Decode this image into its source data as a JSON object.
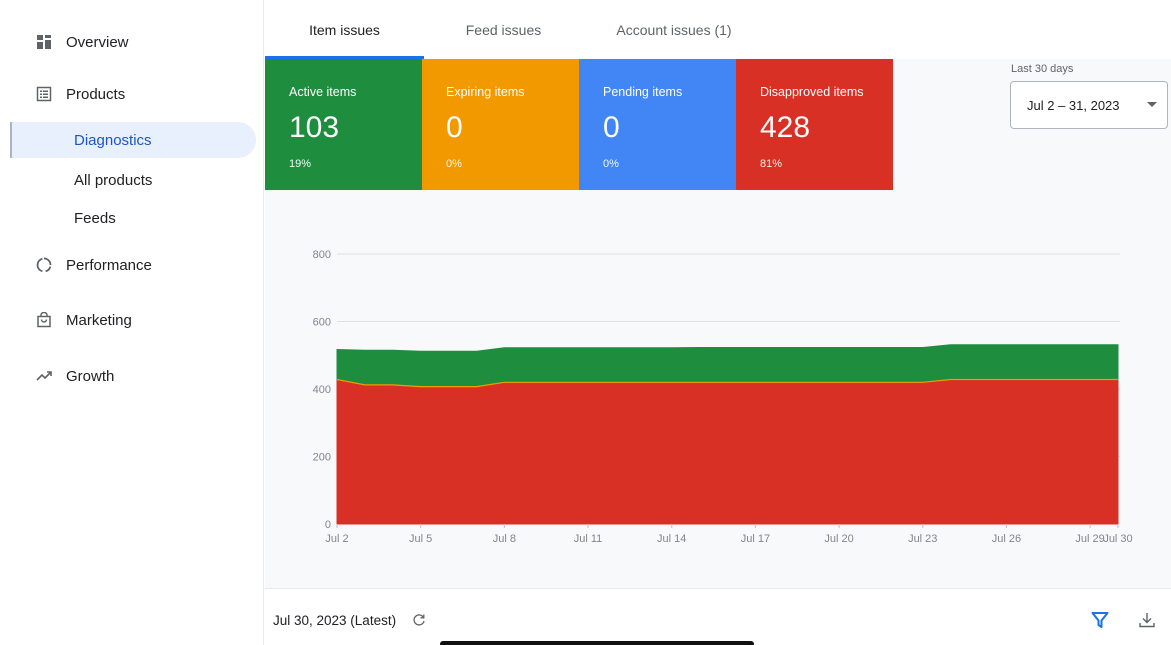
{
  "sidebar": {
    "items": [
      {
        "label": "Overview",
        "icon": "dashboard-icon"
      },
      {
        "label": "Products",
        "icon": "list-icon"
      },
      {
        "label": "Performance",
        "icon": "pie-icon"
      },
      {
        "label": "Marketing",
        "icon": "shopping-bag-icon"
      },
      {
        "label": "Growth",
        "icon": "trending-up-icon"
      }
    ],
    "products_sub": [
      {
        "label": "Diagnostics",
        "active": true
      },
      {
        "label": "All products",
        "active": false
      },
      {
        "label": "Feeds",
        "active": false
      }
    ]
  },
  "tabs": [
    {
      "label": "Item issues",
      "active": true
    },
    {
      "label": "Feed issues",
      "active": false
    },
    {
      "label": "Account issues (1)",
      "active": false
    }
  ],
  "cards": [
    {
      "title": "Active items",
      "value": "103",
      "pct": "19%",
      "color": "#1e8e3e"
    },
    {
      "title": "Expiring items",
      "value": "0",
      "pct": "0%",
      "color": "#f29900"
    },
    {
      "title": "Pending items",
      "value": "0",
      "pct": "0%",
      "color": "#4285f4"
    },
    {
      "title": "Disapproved items",
      "value": "428",
      "pct": "81%",
      "color": "#d93025"
    }
  ],
  "date_range": {
    "caption": "Last 30 days",
    "value": "Jul 2 – 31, 2023"
  },
  "chart_data": {
    "type": "area",
    "stacked": true,
    "ylim": [
      0,
      800
    ],
    "y_ticks": [
      "0",
      "200",
      "400",
      "600",
      "800"
    ],
    "x_ticks": [
      "Jul 2",
      "Jul 5",
      "Jul 8",
      "Jul 11",
      "Jul 14",
      "Jul 17",
      "Jul 20",
      "Jul 23",
      "Jul 26",
      "Jul 29",
      "Jul 30"
    ],
    "x": [
      "Jul 2",
      "Jul 3",
      "Jul 4",
      "Jul 5",
      "Jul 6",
      "Jul 7",
      "Jul 8",
      "Jul 9",
      "Jul 10",
      "Jul 11",
      "Jul 12",
      "Jul 13",
      "Jul 14",
      "Jul 15",
      "Jul 16",
      "Jul 17",
      "Jul 18",
      "Jul 19",
      "Jul 20",
      "Jul 21",
      "Jul 22",
      "Jul 23",
      "Jul 24",
      "Jul 25",
      "Jul 26",
      "Jul 27",
      "Jul 28",
      "Jul 29",
      "Jul 30"
    ],
    "series": [
      {
        "color": "#d93025",
        "values": [
          428,
          412,
          412,
          407,
          407,
          407,
          420,
          420,
          420,
          420,
          420,
          420,
          420,
          420,
          420,
          420,
          420,
          420,
          420,
          420,
          420,
          420,
          428,
          428,
          428,
          428,
          428,
          428,
          428
        ]
      },
      {
        "color": "#f29900",
        "values": [
          0,
          0,
          0,
          0,
          0,
          0,
          0,
          0,
          0,
          0,
          0,
          0,
          0,
          0,
          0,
          0,
          0,
          0,
          0,
          0,
          0,
          0,
          0,
          0,
          0,
          0,
          0,
          0,
          0
        ]
      },
      {
        "color": "#1e8e3e",
        "values": [
          89,
          103,
          103,
          105,
          105,
          105,
          102,
          102,
          102,
          102,
          102,
          102,
          102,
          103,
          103,
          103,
          103,
          103,
          103,
          103,
          103,
          103,
          103,
          103,
          103,
          103,
          103,
          103,
          103
        ]
      }
    ]
  },
  "footer": {
    "date": "Jul 30, 2023 (Latest)"
  }
}
